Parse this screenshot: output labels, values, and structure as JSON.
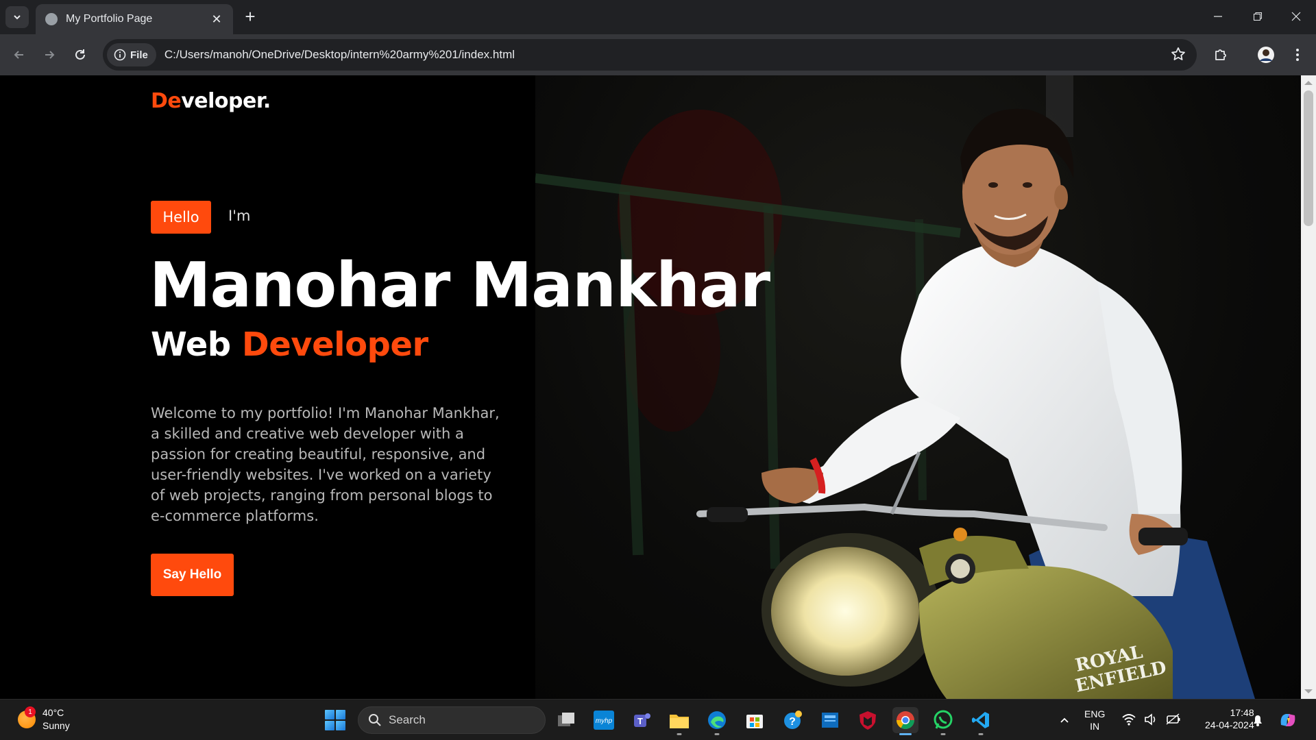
{
  "browser": {
    "tab_title": "My Portfolio Page",
    "chip_label": "File",
    "url": "C:/Users/manoh/OneDrive/Desktop/intern%20army%201/index.html"
  },
  "page": {
    "logo_accent": "De",
    "logo_rest": "veloper.",
    "hello_badge": "Hello",
    "intro": "I'm",
    "name": "Manohar Mankhar",
    "role_prefix": "Web",
    "role_accent": "Developer",
    "bio": "Welcome to my portfolio! I'm Manohar Mankhar, a skilled and creative web developer with a passion for creating beautiful, responsive, and user-friendly websites. I've worked on a variety of web projects, ranging from personal blogs to e-commerce platforms.",
    "cta_label": "Say Hello",
    "photo_caption_text": "ROYAL ENFIELD"
  },
  "colors": {
    "accent": "#ff4a0d",
    "background": "#000000"
  },
  "taskbar": {
    "weather_badge": "1",
    "temperature": "40°C",
    "condition": "Sunny",
    "search_label": "Search",
    "lang_top": "ENG",
    "lang_bottom": "IN",
    "time": "17:48",
    "date": "24-04-2024",
    "apps": [
      "task-view",
      "myhp",
      "teams",
      "file-explorer",
      "edge",
      "microsoft-store",
      "help",
      "news",
      "mcafee",
      "chrome",
      "whatsapp",
      "vscode"
    ]
  }
}
